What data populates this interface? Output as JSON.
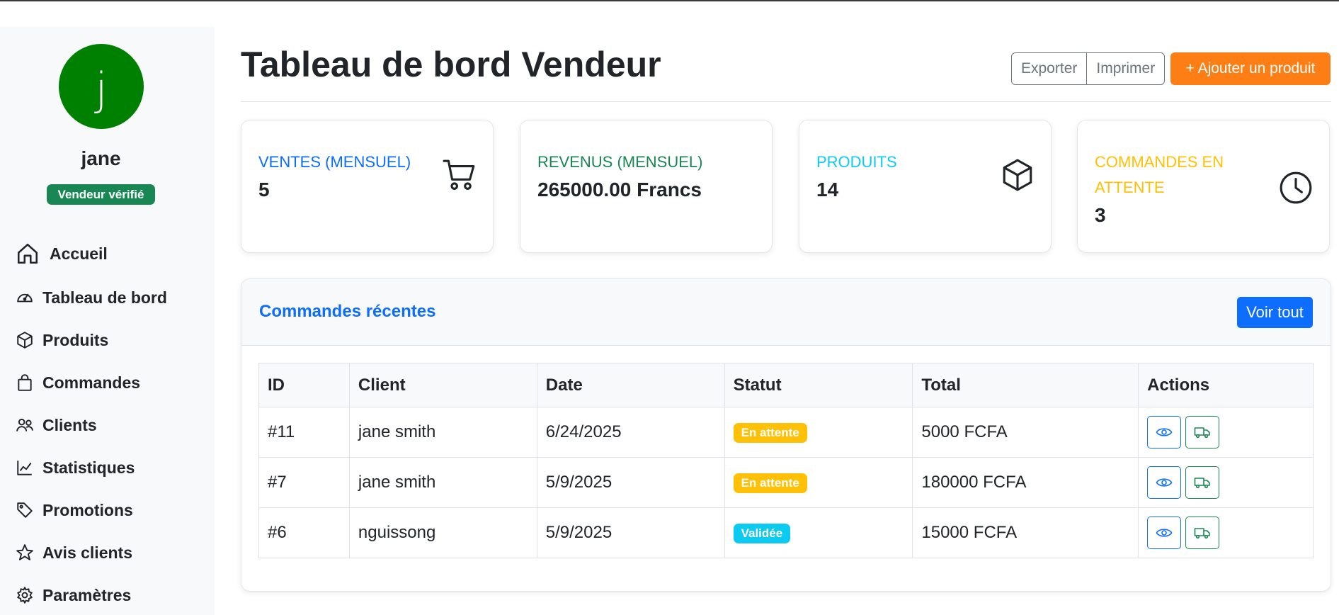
{
  "sidebar": {
    "avatar_initial": "j",
    "username": "jane",
    "badge": "Vendeur vérifié",
    "items": [
      {
        "label": "Accueil",
        "icon": "home-icon"
      },
      {
        "label": "Tableau de bord",
        "icon": "speedometer-icon"
      },
      {
        "label": "Produits",
        "icon": "box-icon"
      },
      {
        "label": "Commandes",
        "icon": "bag-icon"
      },
      {
        "label": "Clients",
        "icon": "people-icon"
      },
      {
        "label": "Statistiques",
        "icon": "graph-icon"
      },
      {
        "label": "Promotions",
        "icon": "tags-icon"
      },
      {
        "label": "Avis clients",
        "icon": "star-icon"
      },
      {
        "label": "Paramètres",
        "icon": "gear-icon"
      }
    ]
  },
  "header": {
    "title": "Tableau de bord Vendeur",
    "export_label": "Exporter",
    "print_label": "Imprimer",
    "add_product_label": "+  Ajouter un produit"
  },
  "stats": [
    {
      "label": "VENTES (MENSUEL)",
      "value": "5",
      "color": "#0d6efd",
      "icon": "cart-icon"
    },
    {
      "label": "REVENUS (MENSUEL)",
      "value": "265000.00 Francs",
      "color": "#198754",
      "icon": ""
    },
    {
      "label": "PRODUITS",
      "value": "14",
      "color": "#0dcaf0",
      "icon": "box-icon"
    },
    {
      "label_line1": "COMMANDES EN",
      "label_line2": "ATTENTE",
      "value": "3",
      "color": "#ffc107",
      "icon": "clock-icon"
    }
  ],
  "orders": {
    "title": "Commandes récentes",
    "view_all_label": "Voir tout",
    "columns": [
      "ID",
      "Client",
      "Date",
      "Statut",
      "Total",
      "Actions"
    ],
    "rows": [
      {
        "id": "#11",
        "client": "jane smith",
        "date": "6/24/2025",
        "status": "En attente",
        "total": "5000 FCFA"
      },
      {
        "id": "#7",
        "client": "jane smith",
        "date": "5/9/2025",
        "status": "En attente",
        "total": "180000 FCFA"
      },
      {
        "id": "#6",
        "client": "nguissong",
        "date": "5/9/2025",
        "status": "Validée",
        "total": "15000 FCFA"
      }
    ]
  },
  "colors": {
    "primary": "#0d6efd",
    "success": "#198754",
    "warning": "#ffc107",
    "info": "#0dcaf0",
    "orange": "#fd7e14",
    "avatar": "#008000"
  }
}
